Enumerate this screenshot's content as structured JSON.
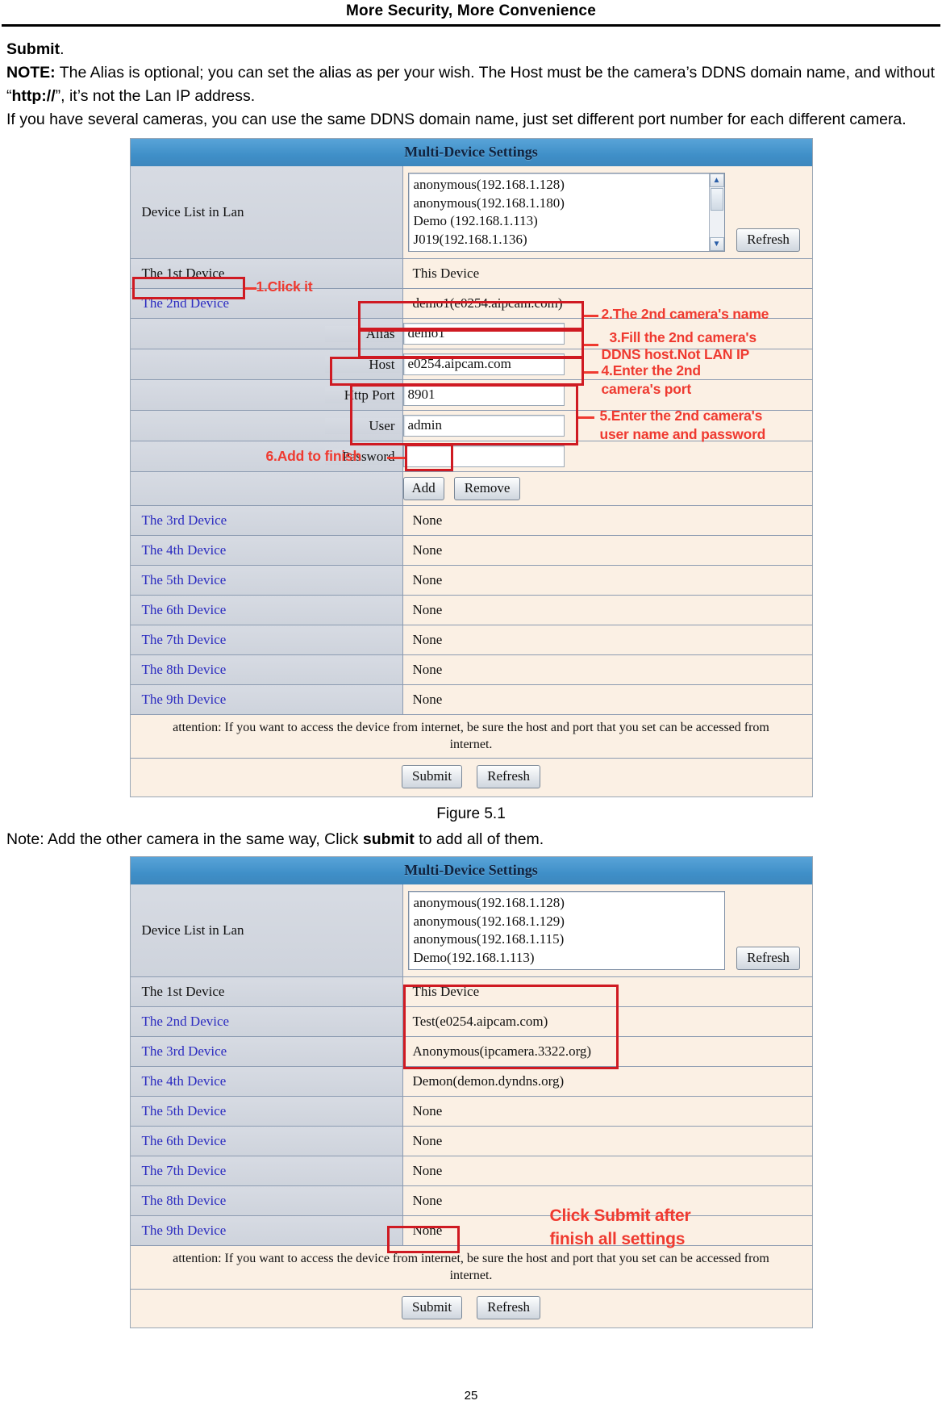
{
  "header": {
    "running_title": "More Security, More Convenience"
  },
  "body": {
    "line_submit_bold": "Submit",
    "line_submit_rest": ".",
    "note_label": "NOTE:",
    "note_text_1": " The Alias is optional; you can set the alias as per your wish. The Host must be the camera’s DDNS domain name, and without “",
    "note_http": "http://",
    "note_text_2": "”, it’s not the Lan IP address.",
    "note_text_3": "If you have several cameras, you can use the same DDNS domain name, just set different port number for each different camera.",
    "figure1_caption": "Figure 5.1",
    "note_after_fig1_a": "Note: Add the other camera in the same way, Click ",
    "note_after_fig1_b": "submit",
    "note_after_fig1_c": " to add all of them.",
    "page_number": "25"
  },
  "figure1": {
    "title": "Multi-Device Settings",
    "device_list_label": "Device List in Lan",
    "device_list_options": [
      "anonymous(192.168.1.128)",
      "anonymous(192.168.1.180)",
      "Demo (192.168.1.113)",
      "J019(192.168.1.136)"
    ],
    "refresh_label": "Refresh",
    "rows": [
      {
        "label": "The 1st Device",
        "value": "This Device"
      },
      {
        "label": "The 2nd Device",
        "value": "demo1(e0254.aipcam.com)"
      },
      {
        "label": "The 3rd Device",
        "value": "None"
      },
      {
        "label": "The 4th Device",
        "value": "None"
      },
      {
        "label": "The 5th Device",
        "value": "None"
      },
      {
        "label": "The 6th Device",
        "value": "None"
      },
      {
        "label": "The 7th Device",
        "value": "None"
      },
      {
        "label": "The 8th Device",
        "value": "None"
      },
      {
        "label": "The 9th Device",
        "value": "None"
      }
    ],
    "fields": {
      "alias_label": "Alias",
      "alias_value": "demo1",
      "host_label": "Host",
      "host_value": "e0254.aipcam.com",
      "http_port_label": "Http Port",
      "http_port_value": "8901",
      "user_label": "User",
      "user_value": "admin",
      "password_label": "Password",
      "password_value": ""
    },
    "add_label": "Add",
    "remove_label": "Remove",
    "attention": "attention: If you want to access the device from internet, be sure the host and port that you set can be accessed from internet.",
    "submit_label": "Submit",
    "footer_refresh_label": "Refresh",
    "annotations": {
      "step1": "1.Click it",
      "step2": "2.The 2nd camera's name",
      "step3_line1": "3.Fill the 2nd camera's",
      "step3_line2": "DDNS host.Not LAN IP",
      "step4_line1": "4.Enter the 2nd",
      "step4_line2": "camera's port",
      "step5_line1": "5.Enter the 2nd camera's",
      "step5_line2": "user name and password",
      "step6": "6.Add to finish"
    }
  },
  "figure2": {
    "title": "Multi-Device Settings",
    "device_list_label": "Device List in Lan",
    "device_list_options": [
      "anonymous(192.168.1.128)",
      "anonymous(192.168.1.129)",
      "anonymous(192.168.1.115)",
      "Demo(192.168.1.113)"
    ],
    "refresh_label": "Refresh",
    "rows": [
      {
        "label": "The 1st Device",
        "value": "This Device"
      },
      {
        "label": "The 2nd Device",
        "value": "Test(e0254.aipcam.com)"
      },
      {
        "label": "The 3rd Device",
        "value": "Anonymous(ipcamera.3322.org)"
      },
      {
        "label": "The 4th Device",
        "value": "Demon(demon.dyndns.org)"
      },
      {
        "label": "The 5th Device",
        "value": "None"
      },
      {
        "label": "The 6th Device",
        "value": "None"
      },
      {
        "label": "The 7th Device",
        "value": "None"
      },
      {
        "label": "The 8th Device",
        "value": "None"
      },
      {
        "label": "The 9th Device",
        "value": "None"
      }
    ],
    "attention": "attention: If you want to access the device from internet, be sure the host and port that you set can be accessed from internet.",
    "submit_label": "Submit",
    "footer_refresh_label": "Refresh",
    "annotations": {
      "click_submit_line1": "Click Submit after",
      "click_submit_line2": "finish all settings"
    }
  },
  "colors": {
    "annotation_red": "#ef3a30",
    "box_red": "#cf1a22",
    "title_blue": "#3f8fc8",
    "row_label_blue": "#2b2bc0"
  }
}
